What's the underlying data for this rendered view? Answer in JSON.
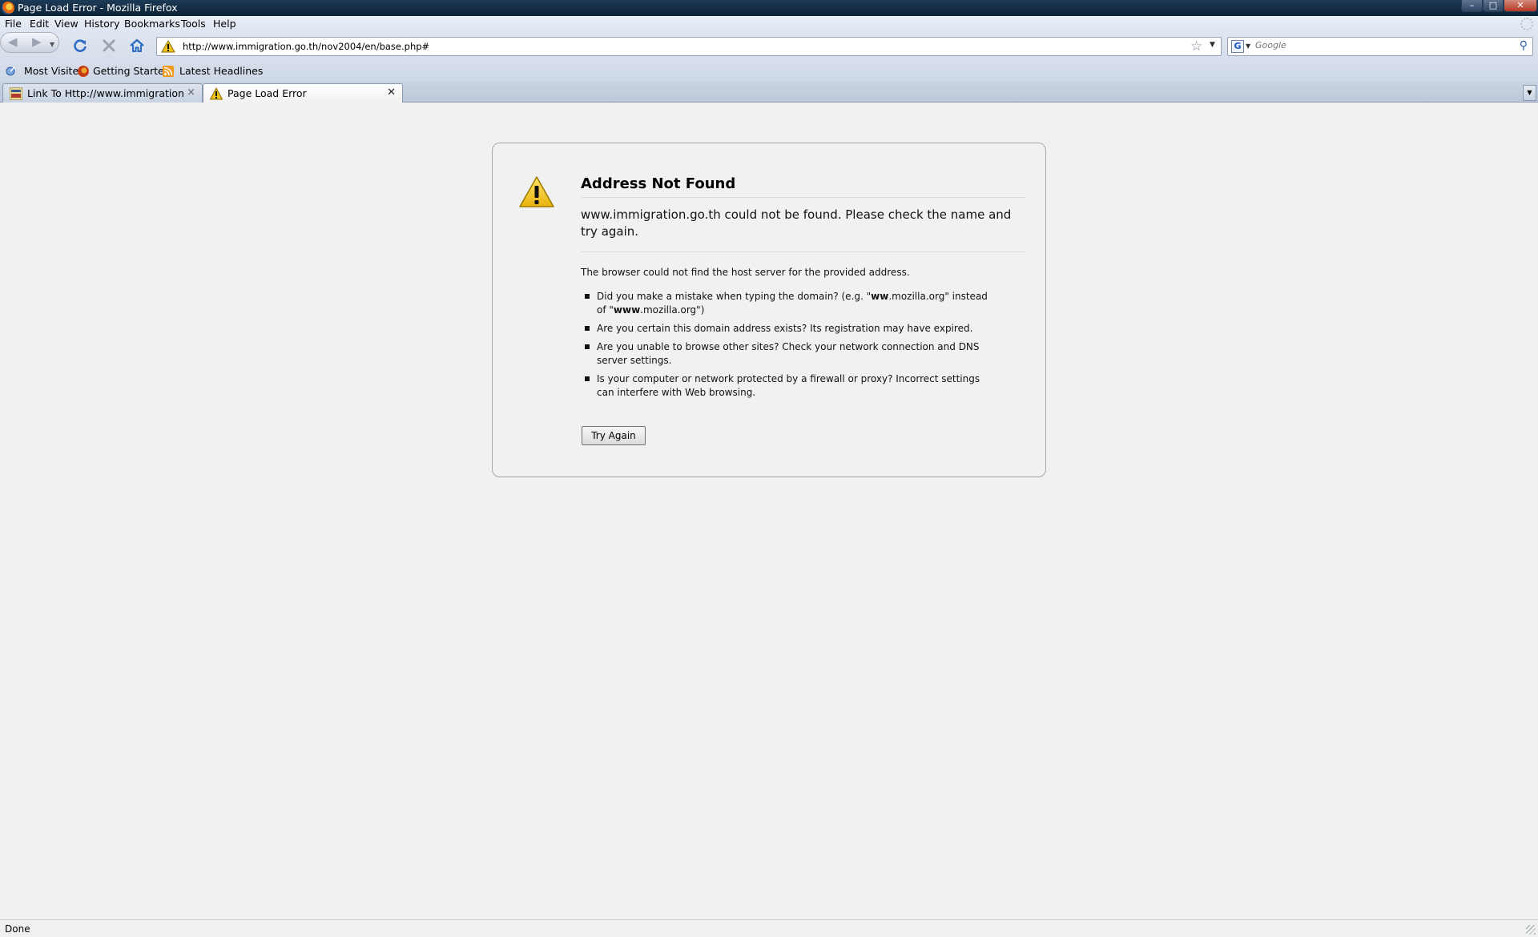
{
  "window": {
    "title": "Page Load Error - Mozilla Firefox",
    "controls": {
      "minimize": "–",
      "maximize": "□",
      "close": "✕"
    }
  },
  "menubar": {
    "items": [
      {
        "label": "File"
      },
      {
        "label": "Edit"
      },
      {
        "label": "View"
      },
      {
        "label": "History"
      },
      {
        "label": "Bookmarks"
      },
      {
        "label": "Tools"
      },
      {
        "label": "Help"
      }
    ]
  },
  "navbar": {
    "back_icon": "◀",
    "forward_icon": "▶",
    "url": "http://www.immigration.go.th/nov2004/en/base.php#",
    "star_icon": "☆",
    "dropdown_icon": "▼"
  },
  "search": {
    "engine_icon": "G",
    "placeholder": "Google",
    "magnifier_icon": "⚲"
  },
  "bookmarks": {
    "items": [
      {
        "label": "Most Visited",
        "icon": "most-visited-icon"
      },
      {
        "label": "Getting Started",
        "icon": "firefox-icon"
      },
      {
        "label": "Latest Headlines",
        "icon": "rss-icon"
      }
    ]
  },
  "tabs": [
    {
      "label": "Link To Http://www.immigration.g...",
      "icon": "site-favicon",
      "selected": false,
      "close": "×"
    },
    {
      "label": "Page Load Error",
      "icon": "warning-icon",
      "selected": true,
      "close": "✕"
    }
  ],
  "tablist_icon": "▼",
  "error": {
    "title": "Address Not Found",
    "short_desc": "www.immigration.go.th could not be found. Please check the name and try again.",
    "long_desc": "The browser could not find the host server for the provided address.",
    "suggestions": [
      {
        "parts": [
          {
            "text": "Did you make a mistake when typing the domain? (e.g. \"",
            "bold": false
          },
          {
            "text": "ww",
            "bold": true
          },
          {
            "text": ".mozilla.org\" instead of \"",
            "bold": false
          },
          {
            "text": "www",
            "bold": true
          },
          {
            "text": ".mozilla.org\")",
            "bold": false
          }
        ]
      },
      {
        "parts": [
          {
            "text": "Are you certain this domain address exists? Its registration may have expired.",
            "bold": false
          }
        ]
      },
      {
        "parts": [
          {
            "text": "Are you unable to browse other sites? Check your network connection and DNS server settings.",
            "bold": false
          }
        ]
      },
      {
        "parts": [
          {
            "text": "Is your computer or network protected by a firewall or proxy? Incorrect settings can interfere with Web browsing.",
            "bold": false
          }
        ]
      }
    ],
    "try_again_label": "Try Again"
  },
  "statusbar": {
    "text": "Done"
  },
  "colors": {
    "titlebar": "#0b2236",
    "toolbar": "#dfe6f1",
    "content_bg": "#f1f1f1",
    "warning_yellow": "#f2c318"
  }
}
